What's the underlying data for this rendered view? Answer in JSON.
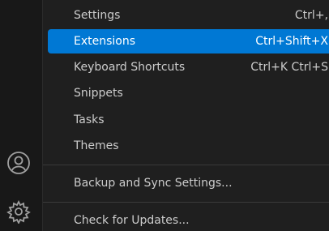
{
  "menu": {
    "items": [
      {
        "label": "Settings",
        "shortcut": "Ctrl+,"
      },
      {
        "label": "Extensions",
        "shortcut": "Ctrl+Shift+X",
        "selected": true
      },
      {
        "label": "Keyboard Shortcuts",
        "shortcut": "Ctrl+K Ctrl+S"
      },
      {
        "label": "Snippets",
        "shortcut": ""
      },
      {
        "label": "Tasks",
        "shortcut": ""
      },
      {
        "label": "Themes",
        "shortcut": "",
        "has_submenu": true
      },
      {
        "label": "Backup and Sync Settings...",
        "shortcut": ""
      },
      {
        "label": "Check for Updates...",
        "shortcut": ""
      }
    ]
  },
  "activity_bar": {
    "icons": [
      "accounts-icon",
      "manage-gear-icon"
    ]
  },
  "colors": {
    "selected_bg": "#0078d4",
    "menu_bg": "#1f1f1f",
    "text": "#cccccc"
  }
}
